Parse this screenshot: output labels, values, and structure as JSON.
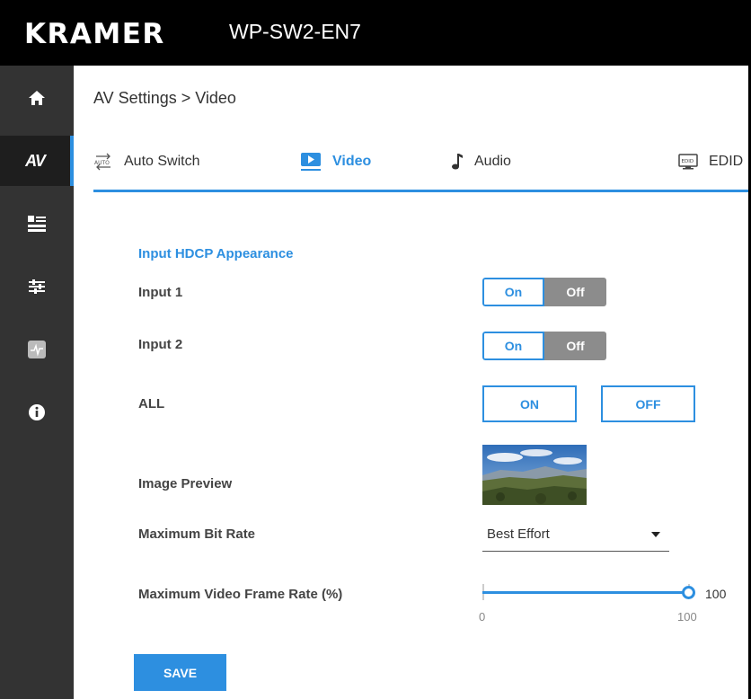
{
  "header": {
    "brand": "KRAMER",
    "model": "WP-SW2-EN7"
  },
  "sidebar": {
    "items": [
      {
        "icon": "home-icon"
      },
      {
        "icon": "av-icon",
        "label": "AV",
        "active": true
      },
      {
        "icon": "device-settings-icon"
      },
      {
        "icon": "sliders-icon"
      },
      {
        "icon": "diagnostics-icon"
      },
      {
        "icon": "info-icon"
      }
    ]
  },
  "breadcrumb": "AV Settings > Video",
  "tabs": [
    {
      "label": "Auto Switch",
      "icon": "auto-switch-icon",
      "active": false
    },
    {
      "label": "Video",
      "icon": "video-icon",
      "active": true
    },
    {
      "label": "Audio",
      "icon": "music-note-icon",
      "active": false
    },
    {
      "label": "EDID",
      "icon": "edid-icon",
      "active": false
    }
  ],
  "hdcp": {
    "section_title": "Input HDCP Appearance",
    "inputs": [
      {
        "label": "Input 1",
        "on_label": "On",
        "off_label": "Off",
        "selected": "On"
      },
      {
        "label": "Input 2",
        "on_label": "On",
        "off_label": "Off",
        "selected": "On"
      }
    ],
    "all": {
      "label": "ALL",
      "on_label": "ON",
      "off_label": "OFF"
    }
  },
  "preview": {
    "label": "Image Preview",
    "icon": "landscape-thumbnail"
  },
  "bitrate": {
    "label": "Maximum Bit Rate",
    "value": "Best Effort"
  },
  "framerate": {
    "label": "Maximum Video Frame Rate (%)",
    "value": "100",
    "min": "0",
    "max": "100",
    "fraction": 1.0
  },
  "save_label": "SAVE",
  "colors": {
    "accent": "#2d8fe0",
    "sidebar": "#333333",
    "topbar": "#000000",
    "toggle_off": "#8c8c8c"
  }
}
